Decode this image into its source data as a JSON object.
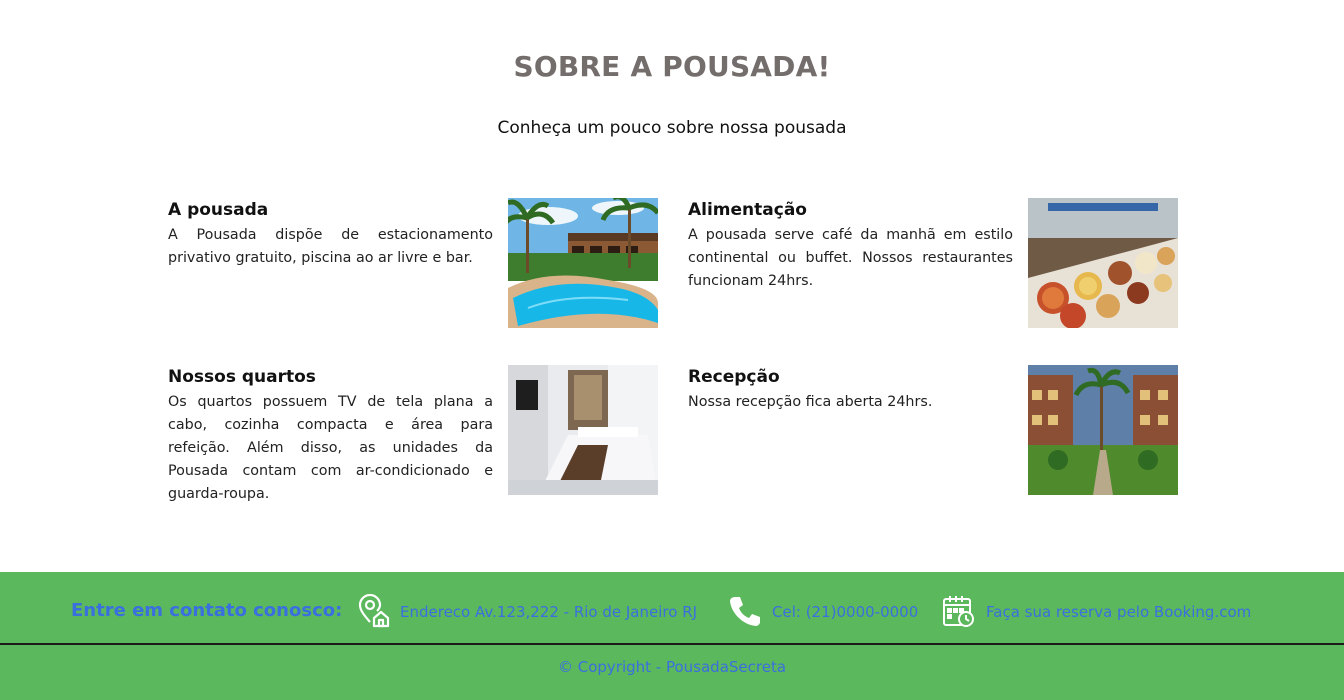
{
  "about": {
    "title": "SOBRE A POUSADA!",
    "subtitle": "Conheça um pouco sobre nossa pousada",
    "cards": [
      {
        "title": "A pousada",
        "text": "A Pousada dispõe de estacionamento privativo gratuito, piscina ao ar livre e bar.",
        "image": "pool-photo"
      },
      {
        "title": "Alimentação",
        "text": "A pousada serve café da manhã em estilo continental ou buffet. Nossos restaurantes funcionam 24hrs.",
        "image": "buffet-photo"
      },
      {
        "title": "Nossos quartos",
        "text": "Os quartos possuem TV de tela plana a cabo, cozinha compacta e área para refeição. Além disso, as unidades da Pousada contam com ar-condicionado e guarda-roupa.",
        "image": "bedroom-photo"
      },
      {
        "title": "Recepção",
        "text": "Nossa recepção fica aberta 24hrs.",
        "image": "courtyard-photo"
      }
    ]
  },
  "footer": {
    "contact_title": "Entre em contato conosco:",
    "address": "Endereco Av.123,222 - Rio de Janeiro RJ",
    "phone": "Cel: (21)0000-0000",
    "booking": "Faça sua reserva pelo Booking.com",
    "copyright": "© Copyright - PousadaSecreta",
    "icons": [
      "location-home-icon",
      "phone-icon",
      "calendar-clock-icon"
    ]
  },
  "colors": {
    "title_gray": "#736d6b",
    "footer_green": "#5cb85c",
    "link_blue": "#3a6fe0"
  }
}
